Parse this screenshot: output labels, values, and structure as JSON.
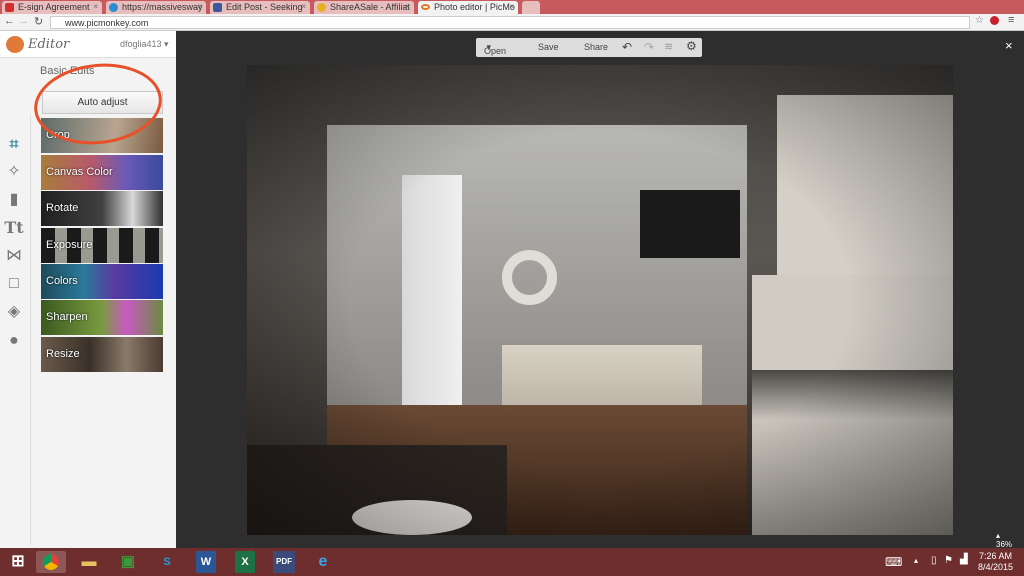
{
  "browser": {
    "tabs": [
      {
        "label": "E-sign Agreement",
        "icon": "pdf-icon",
        "color": "#d32f2f"
      },
      {
        "label": "https://massivesway",
        "icon": "chat-icon",
        "color": "#2a8bd6"
      },
      {
        "label": "Edit Post - Seeking",
        "icon": "list-icon",
        "color": "#3c5a99"
      },
      {
        "label": "ShareASale - Affiliat",
        "icon": "star-icon",
        "color": "#e8b020"
      },
      {
        "label": "Photo editor | PicMo",
        "icon": "eye-icon",
        "color": "#e07820"
      }
    ],
    "url": "www.picmonkey.com"
  },
  "app": {
    "logo_text": "Editor",
    "username": "dfoglia413",
    "section_title": "Basic Edits",
    "auto_adjust": "Auto adjust",
    "tools": [
      "Crop",
      "Canvas Color",
      "Rotate",
      "Exposure",
      "Colors",
      "Sharpen",
      "Resize"
    ],
    "side_icons": [
      "crop-icon",
      "magic-wand-icon",
      "lipstick-icon",
      "text-icon",
      "butterfly-icon",
      "frame-icon",
      "texture-icon",
      "apple-icon"
    ],
    "toolbar": {
      "open": "Open",
      "save": "Save",
      "share": "Share"
    },
    "zoom_level": "36%",
    "accent": "#e8502a"
  },
  "taskbar": {
    "apps": [
      "start",
      "chrome",
      "file-explorer",
      "store",
      "skype",
      "word",
      "excel",
      "pdf",
      "internet-explorer"
    ],
    "time": "7:26 AM",
    "date": "8/4/2015"
  }
}
